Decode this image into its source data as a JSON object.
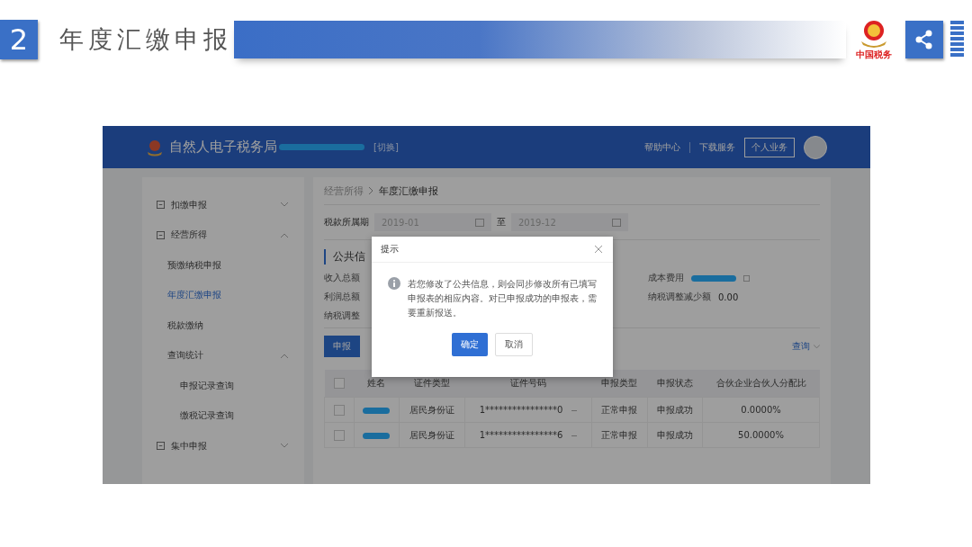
{
  "slide": {
    "number": "2",
    "title": "年度汇缴申报",
    "logo_text": "中国税务"
  },
  "app": {
    "brand": "自然人电子税务局",
    "switch": "[切换]",
    "nav": [
      {
        "label": "帮助中心"
      },
      {
        "label": "下载服务"
      }
    ],
    "account_button": "个人业务"
  },
  "sidebar": {
    "items": [
      {
        "label": "扣缴申报",
        "expanded": false
      },
      {
        "label": "经营所得",
        "expanded": true,
        "children": [
          {
            "label": "预缴纳税申报",
            "selected": false
          },
          {
            "label": "年度汇缴申报",
            "selected": true
          },
          {
            "label": "税款缴纳",
            "selected": false
          },
          {
            "label": "查询统计",
            "selected": false,
            "expanded": true,
            "children": [
              {
                "label": "申报记录查询",
                "selected": false
              },
              {
                "label": "缴税记录查询",
                "selected": false
              }
            ]
          }
        ]
      },
      {
        "label": "集中申报",
        "expanded": false
      }
    ]
  },
  "breadcrumb": [
    "经营所得",
    "年度汇缴申报"
  ],
  "filter": {
    "label": "税款所属期",
    "from": "2019-01",
    "separator": "至",
    "to": "2019-12"
  },
  "public_info": {
    "title": "公共信",
    "left_fields": [
      {
        "label": "收入总额"
      },
      {
        "label": "利润总额"
      },
      {
        "label": "纳税调整"
      }
    ],
    "right_fields": [
      {
        "label": "成本费用"
      },
      {
        "label": "纳税调整减少额",
        "value": "0.00"
      }
    ]
  },
  "actions": {
    "submit": "申报",
    "query": "查询"
  },
  "table": {
    "header_checked": false,
    "columns": [
      "姓名",
      "证件类型",
      "证件号码",
      "申报类型",
      "申报状态",
      "合伙企业合伙人分配比"
    ],
    "rows": [
      {
        "checked": false,
        "id_type": "居民身份证",
        "id_number": "1****************0",
        "filing_type": "正常申报",
        "status": "申报成功",
        "ratio": "0.0000%"
      },
      {
        "checked": false,
        "id_type": "居民身份证",
        "id_number": "1****************6",
        "filing_type": "正常申报",
        "status": "申报成功",
        "ratio": "50.0000%"
      }
    ]
  },
  "dialog": {
    "title": "提示",
    "message": "若您修改了公共信息，则会同步修改所有已填写申报表的相应内容。对已申报成功的申报表，需要重新报送。",
    "confirm": "确定",
    "cancel": "取消"
  }
}
